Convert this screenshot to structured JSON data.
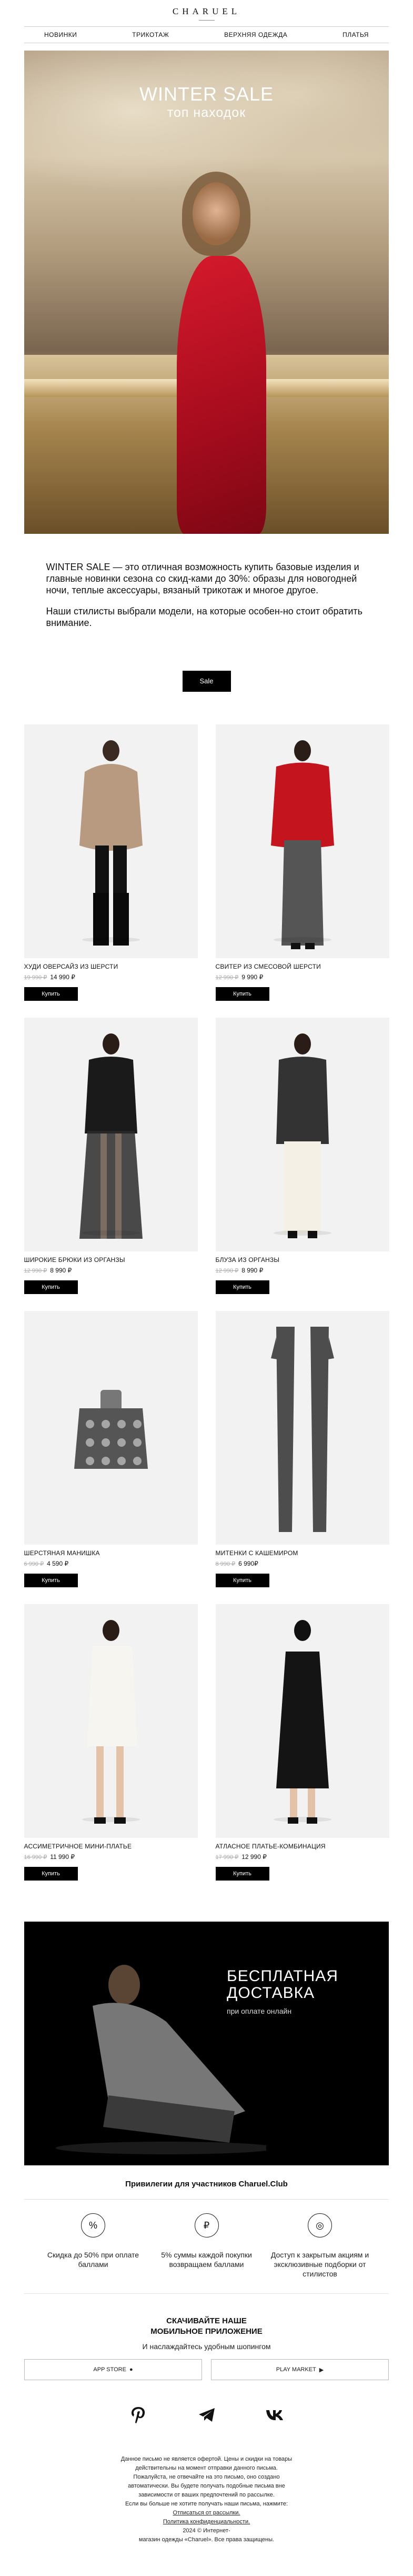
{
  "brand": {
    "logo": "CHARUEL"
  },
  "nav": [
    "НОВИНКИ",
    "ТРИКОТАЖ",
    "ВЕРХНЯЯ ОДЕЖДА",
    "ПЛАТЬЯ"
  ],
  "hero": {
    "title": "WINTER SALE",
    "subtitle": "топ находок"
  },
  "intro": {
    "p1": "WINTER SALE — это отличная возможность купить базовые изделия и главные новинки сезона со скид-ками до 30%: образы для новогодней ночи, теплые аксессуары, вязаный трикотаж и многое другое.",
    "p2": "Наши стилисты выбрали модели, на которые особен-но стоит обратить внимание."
  },
  "sale_button": "Sale",
  "products": [
    {
      "name": "ХУДИ ОВЕРСАЙЗ ИЗ ШЕРСТИ",
      "old_price": "19 990 ₽",
      "price": "14 990 ₽",
      "buy": "Купить"
    },
    {
      "name": "СВИТЕР ИЗ СМЕСОВОЙ ШЕРСТИ",
      "old_price": "12 990 ₽",
      "price": "9 990 ₽",
      "buy": "Купить"
    },
    {
      "name": "ШИРОКИЕ БРЮКИ ИЗ ОРГАНЗЫ",
      "old_price": "12 990 ₽",
      "price": "8 990 ₽",
      "buy": "Купить"
    },
    {
      "name": "БЛУЗА ИЗ ОРГАНЗЫ",
      "old_price": "12 990 ₽",
      "price": "8 990 ₽",
      "buy": "Купить"
    },
    {
      "name": "ШЕРСТЯНАЯ МАНИШКА",
      "old_price": "6 990 ₽",
      "price": "4 590 ₽",
      "buy": "Купить"
    },
    {
      "name": "МИТЕНКИ С КАШЕМИРОМ",
      "old_price": "8 990 ₽",
      "price": "6 990₽",
      "buy": "Купить"
    },
    {
      "name": "АССИМЕТРИЧНОЕ МИНИ-ПЛАТЬЕ",
      "old_price": "16 990 ₽",
      "price": "11 990 ₽",
      "buy": "Купить"
    },
    {
      "name": "АТЛАСНОЕ ПЛАТЬЕ-КОМБИНАЦИЯ",
      "old_price": "17 990 ₽",
      "price": "12 990 ₽",
      "buy": "Купить"
    }
  ],
  "promo": {
    "line1": "БЕСПЛАТНАЯ",
    "line2": "ДОСТАВКА",
    "note": "при оплате онлайн"
  },
  "club": {
    "title": "Привилегии для участников Charuel.Club",
    "benefits": [
      {
        "icon": "percent-icon",
        "text": "Скидка до 50% при оплате баллами"
      },
      {
        "icon": "ruble-icon",
        "text": "5% суммы каждой покупки возвращаем баллами"
      },
      {
        "icon": "rings-icon",
        "text": "Доступ к закрытым акциям и эксклюзивные подборки от стилистов"
      }
    ]
  },
  "app": {
    "title_line1": "СКАЧИВАЙТЕ НАШЕ",
    "title_line2": "МОБИЛЬНОЕ ПРИЛОЖЕНИЕ",
    "subtitle": "И наслаждайтесь удобным шопингом",
    "app_store": "APP STORE",
    "play_market": "PLAY MARKET"
  },
  "social": [
    "pinterest-icon",
    "telegram-icon",
    "vk-icon"
  ],
  "footer": {
    "l1": "Данное письмо не является офертой. Цены и скидки на товары",
    "l2": "действительны на момент отправки данного письма.",
    "l3": "Пожалуйста, не отвечайте на это письмо, оно создано",
    "l4": "автоматически. Вы будете получать подобные письма вне",
    "l5": "зависимости от ваших предпочтений по рассылке.",
    "l6": "Если вы больше не хотите получать наши письма, нажмите:",
    "l7": "Отписаться от рассылки.",
    "l8": "Политика конфиденциальности.",
    "l9": "2024 © Интернет-",
    "l10": "магазин одежды «Charuel». Все права защищены."
  },
  "colors": {
    "accent": "#000000",
    "hero_dress": "#c8102e"
  }
}
